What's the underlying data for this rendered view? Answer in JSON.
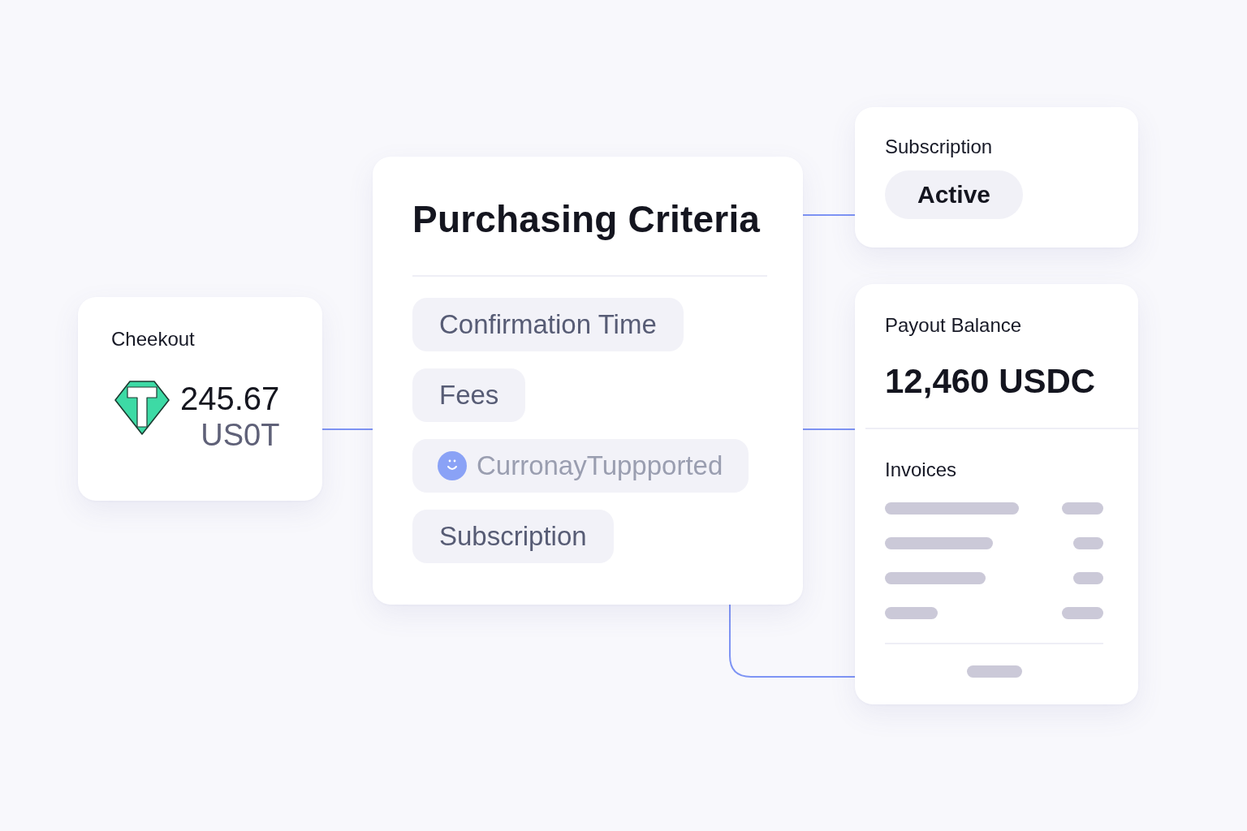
{
  "checkout": {
    "title": "Cheekout",
    "amount": "245.67",
    "currency": "US0T"
  },
  "criteria": {
    "title": "Purchasing Criteria",
    "items": [
      {
        "label": "Confirmation Time",
        "kind": "plain",
        "disabled": false
      },
      {
        "label": "Fees",
        "kind": "plain",
        "disabled": false
      },
      {
        "label": "CurronayTuppported",
        "kind": "icon",
        "disabled": true
      },
      {
        "label": "Subscription",
        "kind": "plain",
        "disabled": false
      }
    ]
  },
  "subscription": {
    "title": "Subscription",
    "status": "Active"
  },
  "payout": {
    "title": "Payout Balance",
    "balance": "12,460 USDC",
    "invoices": {
      "title": "Invoices"
    }
  }
}
